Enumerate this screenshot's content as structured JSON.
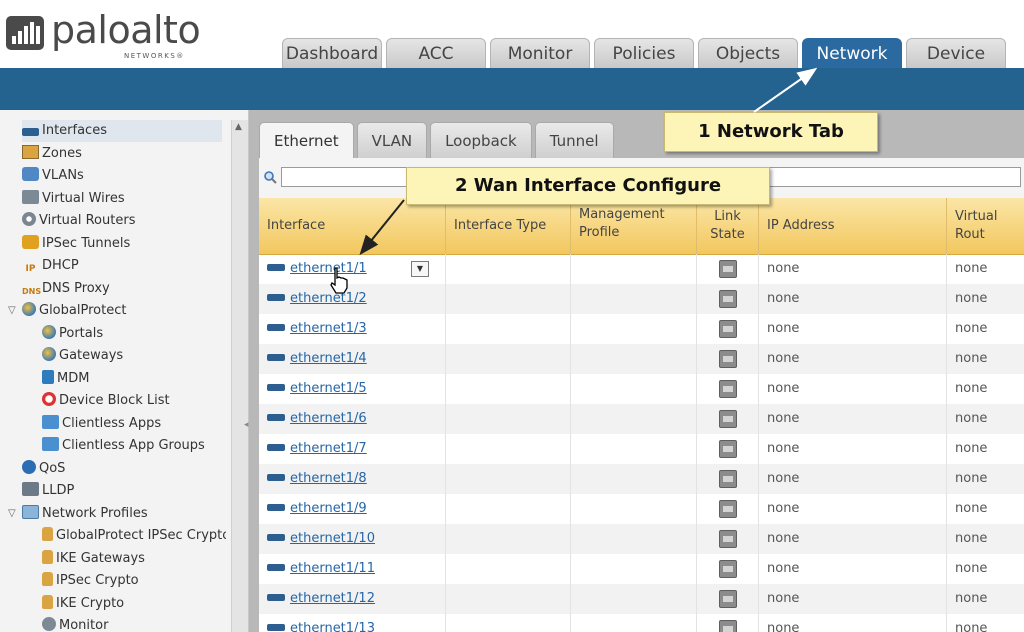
{
  "brand": {
    "name": "paloalto",
    "sub": "NETWORKS®"
  },
  "main_tabs": [
    {
      "label": "Dashboard"
    },
    {
      "label": "ACC"
    },
    {
      "label": "Monitor"
    },
    {
      "label": "Policies"
    },
    {
      "label": "Objects"
    },
    {
      "label": "Network",
      "active": true
    },
    {
      "label": "Device"
    }
  ],
  "sidebar": {
    "items": [
      {
        "label": "Interfaces",
        "icon": "interface-icon"
      },
      {
        "label": "Zones",
        "icon": "zone-icon"
      },
      {
        "label": "VLANs",
        "icon": "vlan-icon"
      },
      {
        "label": "Virtual Wires",
        "icon": "virtual-wire-icon"
      },
      {
        "label": "Virtual Routers",
        "icon": "router-icon"
      },
      {
        "label": "IPSec Tunnels",
        "icon": "tunnel-icon"
      },
      {
        "label": "DHCP",
        "icon": "dhcp-icon"
      },
      {
        "label": "DNS Proxy",
        "icon": "dns-icon"
      },
      {
        "label": "GlobalProtect",
        "icon": "globe-icon"
      },
      {
        "label": "Portals",
        "icon": "globe-icon"
      },
      {
        "label": "Gateways",
        "icon": "globe-icon"
      },
      {
        "label": "MDM",
        "icon": "mdm-icon"
      },
      {
        "label": "Device Block List",
        "icon": "block-icon"
      },
      {
        "label": "Clientless Apps",
        "icon": "apps-icon"
      },
      {
        "label": "Clientless App Groups",
        "icon": "apps-icon"
      },
      {
        "label": "QoS",
        "icon": "qos-icon"
      },
      {
        "label": "LLDP",
        "icon": "lldp-icon"
      },
      {
        "label": "Network Profiles",
        "icon": "folder-icon"
      },
      {
        "label": "GlobalProtect IPSec Crypto",
        "icon": "lock-icon"
      },
      {
        "label": "IKE Gateways",
        "icon": "lock-icon"
      },
      {
        "label": "IPSec Crypto",
        "icon": "lock-icon"
      },
      {
        "label": "IKE Crypto",
        "icon": "lock-icon"
      },
      {
        "label": "Monitor",
        "icon": "monitor-icon"
      }
    ]
  },
  "sub_tabs": [
    {
      "label": "Ethernet",
      "active": true
    },
    {
      "label": "VLAN"
    },
    {
      "label": "Loopback"
    },
    {
      "label": "Tunnel"
    }
  ],
  "search": {
    "value": ""
  },
  "table": {
    "headers": [
      "Interface",
      "Interface Type",
      "Management Profile",
      "Link State",
      "IP Address",
      "Virtual Rout"
    ],
    "rows": [
      {
        "interface": "ethernet1/1",
        "ip": "none",
        "vr": "none"
      },
      {
        "interface": "ethernet1/2",
        "ip": "none",
        "vr": "none"
      },
      {
        "interface": "ethernet1/3",
        "ip": "none",
        "vr": "none"
      },
      {
        "interface": "ethernet1/4",
        "ip": "none",
        "vr": "none"
      },
      {
        "interface": "ethernet1/5",
        "ip": "none",
        "vr": "none"
      },
      {
        "interface": "ethernet1/6",
        "ip": "none",
        "vr": "none"
      },
      {
        "interface": "ethernet1/7",
        "ip": "none",
        "vr": "none"
      },
      {
        "interface": "ethernet1/8",
        "ip": "none",
        "vr": "none"
      },
      {
        "interface": "ethernet1/9",
        "ip": "none",
        "vr": "none"
      },
      {
        "interface": "ethernet1/10",
        "ip": "none",
        "vr": "none"
      },
      {
        "interface": "ethernet1/11",
        "ip": "none",
        "vr": "none"
      },
      {
        "interface": "ethernet1/12",
        "ip": "none",
        "vr": "none"
      },
      {
        "interface": "ethernet1/13",
        "ip": "none",
        "vr": "none"
      }
    ]
  },
  "callouts": {
    "network_tab": "1 Network Tab",
    "wan_config": "2 Wan Interface Configure"
  },
  "colors": {
    "accent": "#24628f",
    "header_gold": "#f2c75e",
    "callout_bg": "#fdf5b8"
  }
}
